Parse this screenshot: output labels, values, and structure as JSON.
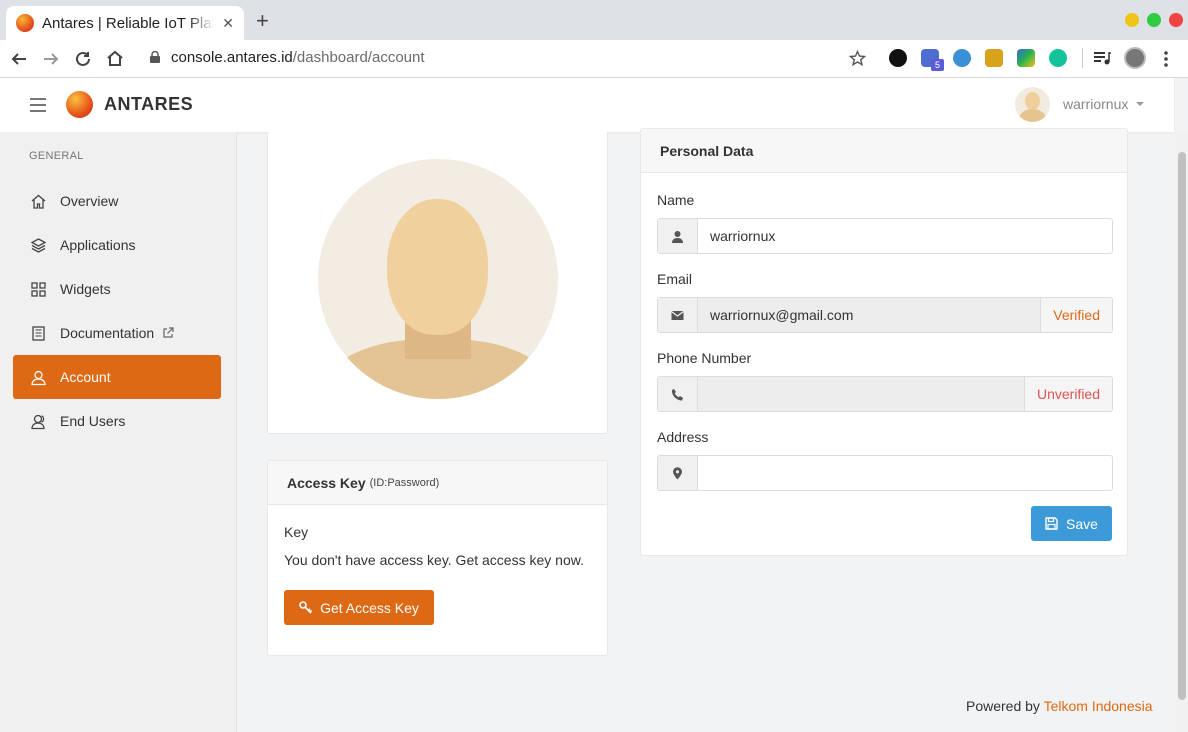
{
  "browser": {
    "tab_title": "Antares | Reliable IoT Platform",
    "tab_close": "✕",
    "new_tab": "+",
    "url_host": "console.antares.id",
    "url_path": "/dashboard/account",
    "ext_badge": "5"
  },
  "header": {
    "brand": "ANTARES",
    "username": "warriornux"
  },
  "sidebar": {
    "heading": "GENERAL",
    "items": [
      {
        "label": "Overview",
        "icon": "home-icon"
      },
      {
        "label": "Applications",
        "icon": "layers-icon"
      },
      {
        "label": "Widgets",
        "icon": "grid-icon"
      },
      {
        "label": "Documentation",
        "icon": "book-icon"
      },
      {
        "label": "Account",
        "icon": "user-icon"
      },
      {
        "label": "End Users",
        "icon": "users-icon"
      }
    ]
  },
  "access_key": {
    "title": "Access Key",
    "subtitle": "(ID:Password)",
    "key_label": "Key",
    "message": "You don't have access key. Get access key now.",
    "button": "Get Access Key"
  },
  "personal": {
    "title": "Personal Data",
    "name_label": "Name",
    "name_value": "warriornux",
    "email_label": "Email",
    "email_value": "warriornux@gmail.com",
    "email_status": "Verified",
    "phone_label": "Phone Number",
    "phone_value": "",
    "phone_status": "Unverified",
    "address_label": "Address",
    "address_value": "",
    "save": "Save"
  },
  "footer": {
    "text": "Powered by",
    "link": "Telkom Indonesia"
  },
  "colors": {
    "accent": "#de6914",
    "save_button": "#3d9ad8",
    "verified": "#de6914",
    "unverified": "#e05252"
  }
}
